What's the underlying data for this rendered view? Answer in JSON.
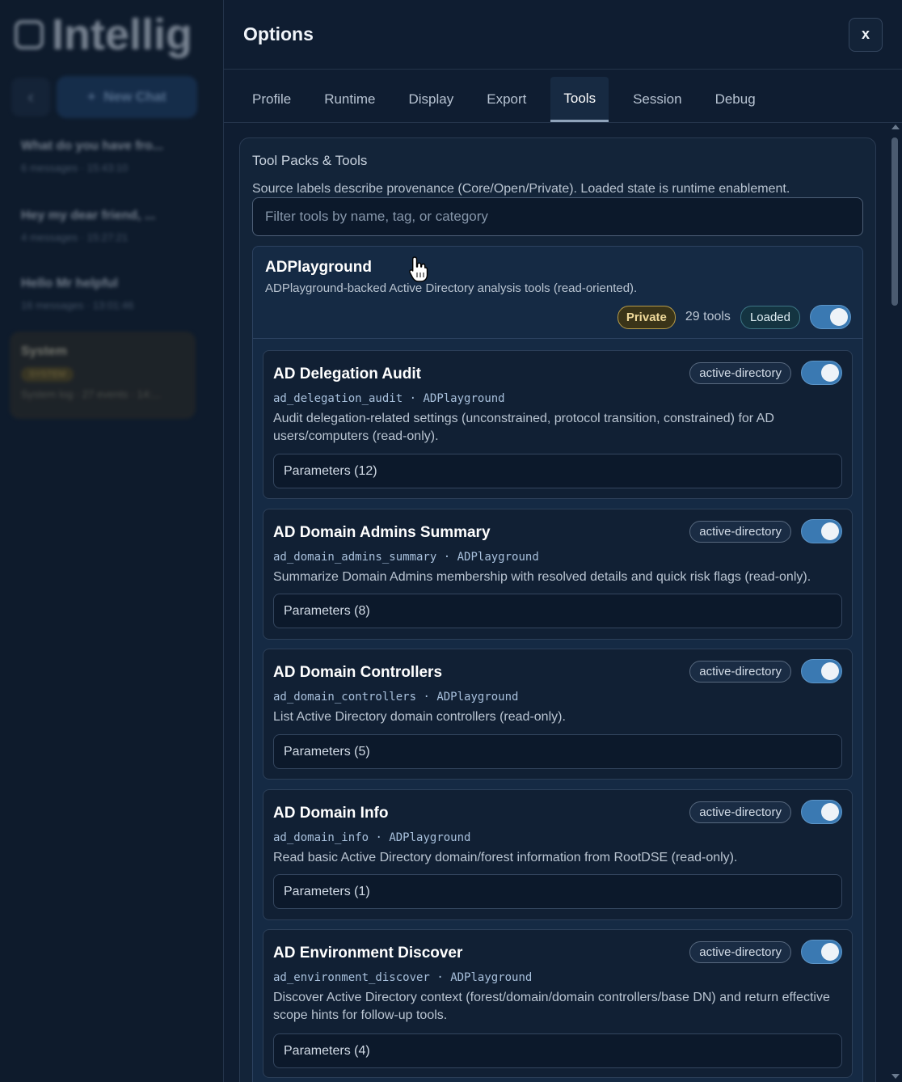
{
  "background_app": {
    "title": "Intellig",
    "new_chat_label": "New Chat",
    "conversations": [
      {
        "title": "What do you have fro...",
        "meta": "6 messages · 15:43:10"
      },
      {
        "title": "Hey my dear friend, ...",
        "meta": "4 messages · 15:27:21"
      },
      {
        "title": "Hello Mr helpful",
        "meta": "16 messages · 13:01:46"
      }
    ],
    "system": {
      "title": "System",
      "badge": "SYSTEM",
      "meta": "System log · 27 events · 14:..."
    }
  },
  "options": {
    "title": "Options",
    "close_label": "x",
    "tabs": [
      {
        "label": "Profile"
      },
      {
        "label": "Runtime"
      },
      {
        "label": "Display"
      },
      {
        "label": "Export"
      },
      {
        "label": "Tools",
        "active": true
      },
      {
        "label": "Session"
      },
      {
        "label": "Debug"
      }
    ],
    "tools_section": {
      "title": "Tool Packs & Tools",
      "description": "Source labels describe provenance (Core/Open/Private). Loaded state is runtime enablement.",
      "filter_placeholder": "Filter tools by name, tag, or category",
      "pack": {
        "name": "ADPlayground",
        "description": "ADPlayground-backed Active Directory analysis tools (read-oriented).",
        "source_badge": "Private",
        "tool_count": "29 tools",
        "state_badge": "Loaded",
        "enabled": true
      },
      "tools": [
        {
          "name": "AD Delegation Audit",
          "tag": "active-directory",
          "id": "ad_delegation_audit",
          "separator": "·",
          "pack": "ADPlayground",
          "description": "Audit delegation-related settings (unconstrained, protocol transition, constrained) for AD users/computers (read-only).",
          "params": "Parameters (12)",
          "enabled": true
        },
        {
          "name": "AD Domain Admins Summary",
          "tag": "active-directory",
          "id": "ad_domain_admins_summary",
          "separator": "·",
          "pack": "ADPlayground",
          "description": "Summarize Domain Admins membership with resolved details and quick risk flags (read-only).",
          "params": "Parameters (8)",
          "enabled": true
        },
        {
          "name": "AD Domain Controllers",
          "tag": "active-directory",
          "id": "ad_domain_controllers",
          "separator": "·",
          "pack": "ADPlayground",
          "description": "List Active Directory domain controllers (read-only).",
          "params": "Parameters (5)",
          "enabled": true
        },
        {
          "name": "AD Domain Info",
          "tag": "active-directory",
          "id": "ad_domain_info",
          "separator": "·",
          "pack": "ADPlayground",
          "description": "Read basic Active Directory domain/forest information from RootDSE (read-only).",
          "params": "Parameters (1)",
          "enabled": true
        },
        {
          "name": "AD Environment Discover",
          "tag": "active-directory",
          "id": "ad_environment_discover",
          "separator": "·",
          "pack": "ADPlayground",
          "description": "Discover Active Directory context (forest/domain/domain controllers/base DN) and return effective scope hints for follow-up tools.",
          "params": "Parameters (4)",
          "enabled": true
        }
      ]
    }
  },
  "colors": {
    "panel_bg": "#0f1d31",
    "toggle_on": "#3a79b2",
    "private_badge": "#b79c49",
    "loaded_badge": "#3d7585"
  },
  "icons": {
    "close": "close-icon",
    "cursor": "pointer-hand-icon"
  }
}
